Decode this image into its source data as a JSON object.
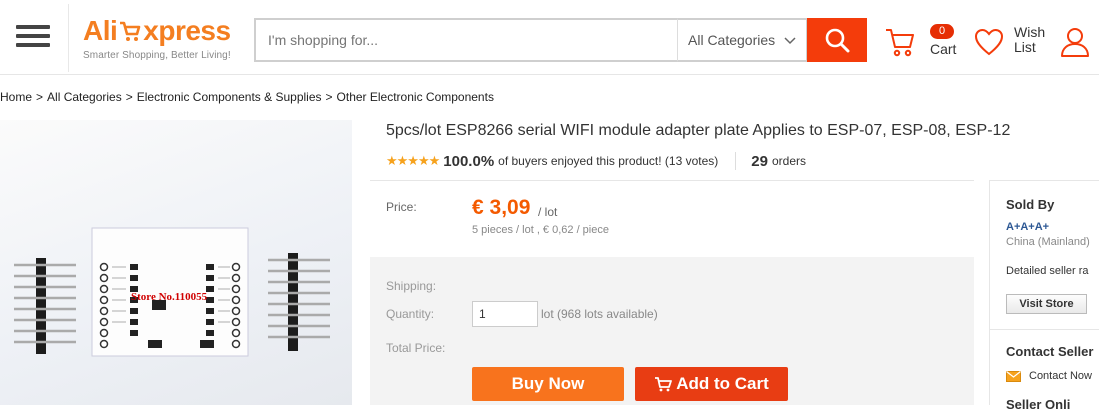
{
  "header": {
    "logo_left": "Ali",
    "logo_right": "xpress",
    "tagline": "Smarter Shopping, Better Living!",
    "search_placeholder": "I'm shopping for...",
    "category": "All Categories",
    "cart_count": "0",
    "cart_label": "Cart",
    "wish_label": "Wish List",
    "brand_color": "#f47e20",
    "search_button_color": "#f43c0b"
  },
  "breadcrumb": [
    "Home",
    "All Categories",
    "Electronic Components & Supplies",
    "Other Electronic Components"
  ],
  "product": {
    "title": "5pcs/lot ESP8266 serial WIFI module adapter plate Applies to ESP-07, ESP-08, ESP-12",
    "rating_percent": "100.0%",
    "rating_text": "of buyers enjoyed this product! (13 votes)",
    "orders": "29",
    "orders_label": "orders",
    "price_label": "Price:",
    "price": "€ 3,09",
    "price_unit": "/ lot",
    "price_sub": "5 pieces / lot , € 0,62 / piece",
    "shipping_label": "Shipping:",
    "quantity_label": "Quantity:",
    "quantity_value": "1",
    "quantity_note": "lot (968 lots available)",
    "total_label": "Total Price:",
    "buy_now": "Buy Now",
    "add_to_cart": "Add to Cart",
    "image_watermark": "Store No.110055"
  },
  "seller": {
    "sold_by": "Sold By",
    "store_name": "A+A+A+",
    "location": "China (Mainland)",
    "detailed": "Detailed seller ra",
    "visit_store": "Visit Store",
    "contact_heading": "Contact Seller",
    "contact_now": "Contact Now",
    "seller_online": "Seller Onli"
  }
}
